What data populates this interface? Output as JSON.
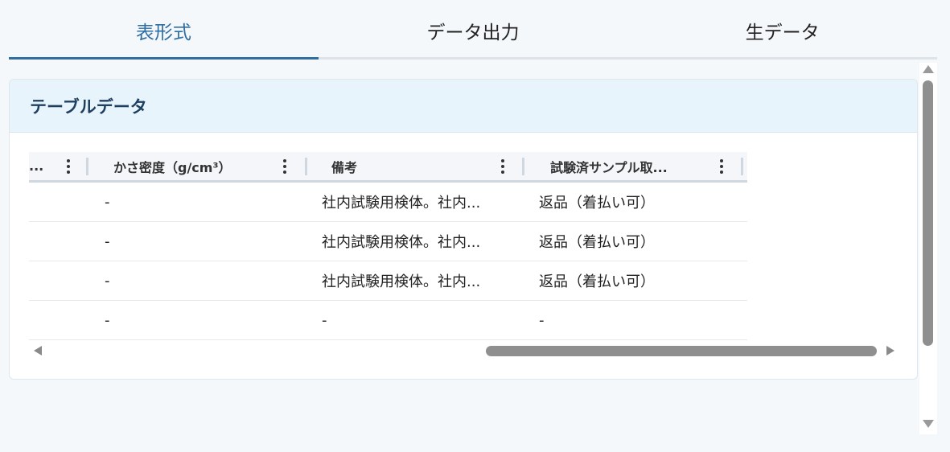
{
  "tabs": [
    {
      "label": "表形式",
      "active": true
    },
    {
      "label": "データ出力",
      "active": false
    },
    {
      "label": "生データ",
      "active": false
    }
  ],
  "card": {
    "title": "テーブルデータ"
  },
  "table": {
    "headers": [
      {
        "label": "..."
      },
      {
        "label": "かさ密度（g/cm³）"
      },
      {
        "label": "備考"
      },
      {
        "label": "試験済サンプル取..."
      }
    ],
    "rows": [
      [
        "",
        "-",
        "社内試験用検体。社内...",
        "返品（着払い可）"
      ],
      [
        "",
        "-",
        "社内試験用検体。社内...",
        "返品（着払い可）"
      ],
      [
        "",
        "-",
        "社内試験用検体。社内...",
        "返品（着払い可）"
      ],
      [
        "",
        "-",
        "-",
        "-"
      ]
    ]
  },
  "colors": {
    "accent": "#2f6ea3",
    "header_bg": "#e8f4fc",
    "scrollbar": "#8f8f8f"
  },
  "icons": {
    "column_menu": "vertical-dots-icon",
    "scroll_up": "triangle-up-icon",
    "scroll_down": "triangle-down-icon",
    "scroll_left": "triangle-left-icon",
    "scroll_right": "triangle-right-icon"
  }
}
